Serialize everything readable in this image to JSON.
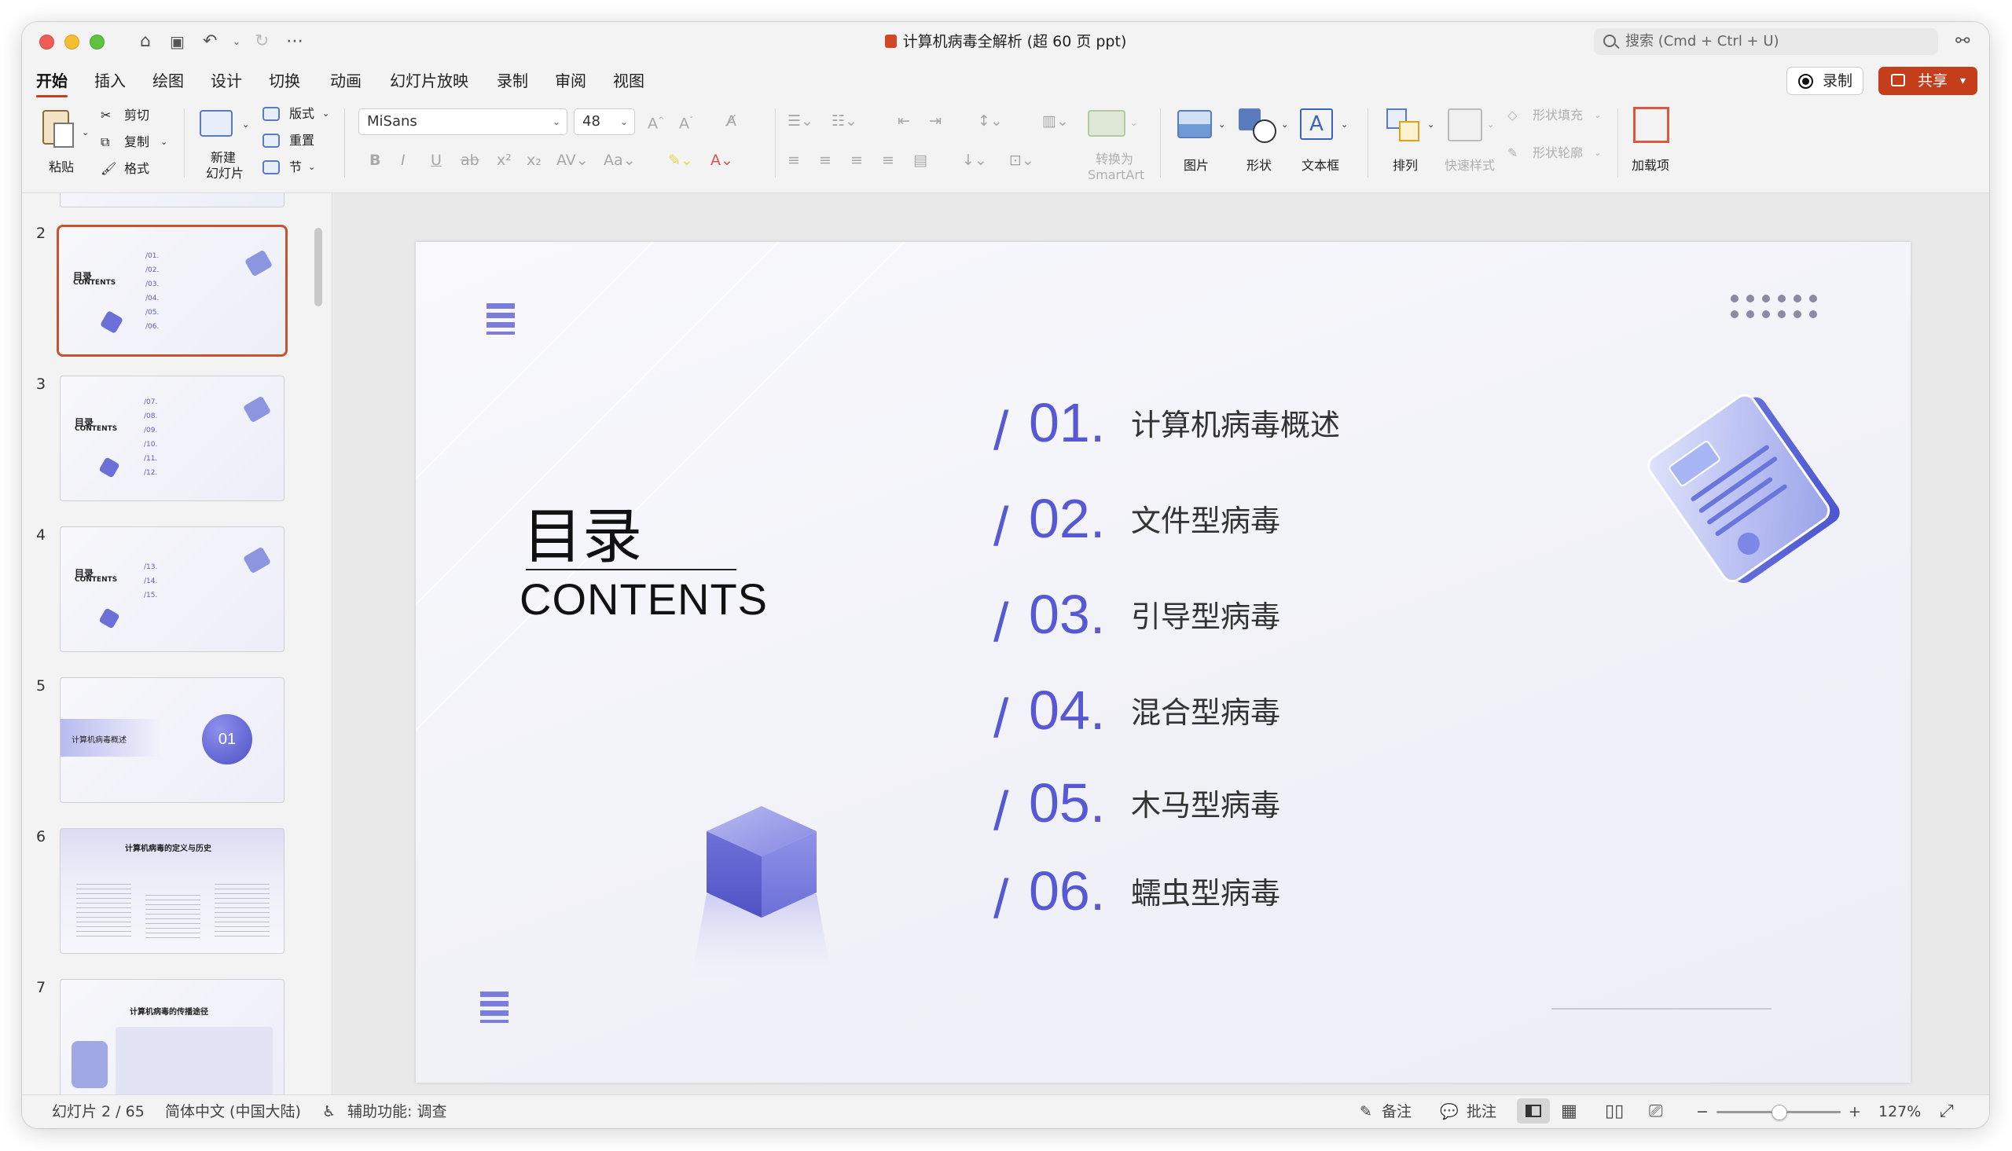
{
  "window": {
    "title": "计算机病毒全解析 (超 60 页 ppt)",
    "search_placeholder": "搜索 (Cmd + Ctrl + U)"
  },
  "menus": [
    "开始",
    "插入",
    "绘图",
    "设计",
    "切换",
    "动画",
    "幻灯片放映",
    "录制",
    "审阅",
    "视图"
  ],
  "actions": {
    "record": "录制",
    "share": "共享"
  },
  "ribbon": {
    "paste": "粘贴",
    "cut": "剪切",
    "copy": "复制",
    "format": "格式",
    "new_slide_1": "新建",
    "new_slide_2": "幻灯片",
    "layout": "版式",
    "reset": "重置",
    "section": "节",
    "font_name": "MiSans",
    "font_size": "48",
    "smartart_1": "转换为",
    "smartart_2": "SmartArt",
    "picture": "图片",
    "shapes": "形状",
    "textbox": "文本框",
    "arrange": "排列",
    "quick_styles": "快速样式",
    "shape_fill": "形状填充",
    "shape_outline": "形状轮廓",
    "addins": "加载项"
  },
  "thumbnails": [
    {
      "num": "2",
      "items": [
        "/01.",
        "/02.",
        "/03.",
        "/04.",
        "/05.",
        "/06."
      ],
      "heading": "目录",
      "sub": "CONTENTS"
    },
    {
      "num": "3",
      "items": [
        "/07.",
        "/08.",
        "/09.",
        "/10.",
        "/11.",
        "/12."
      ],
      "heading": "目录",
      "sub": "CONTENTS"
    },
    {
      "num": "4",
      "items": [
        "/13.",
        "/14.",
        "/15."
      ],
      "heading": "目录",
      "sub": "CONTENTS"
    },
    {
      "num": "5",
      "title": "计算机病毒概述",
      "badge": "01"
    },
    {
      "num": "6",
      "title": "计算机病毒的定义与历史"
    },
    {
      "num": "7",
      "title": "计算机病毒的传播途径"
    }
  ],
  "slide": {
    "heading": "目录",
    "subheading": "CONTENTS",
    "items": [
      {
        "num": "01.",
        "label": "计算机病毒概述"
      },
      {
        "num": "02.",
        "label": "文件型病毒"
      },
      {
        "num": "03.",
        "label": "引导型病毒"
      },
      {
        "num": "04.",
        "label": "混合型病毒"
      },
      {
        "num": "05.",
        "label": "木马型病毒"
      },
      {
        "num": "06.",
        "label": "蠕虫型病毒"
      }
    ],
    "accent": "#5658d4"
  },
  "status": {
    "slide_pos": "幻灯片 2 / 65",
    "language": "简体中文 (中国大陆)",
    "accessibility": "辅助功能: 调查",
    "notes": "备注",
    "comments": "批注",
    "zoom": "127%"
  }
}
